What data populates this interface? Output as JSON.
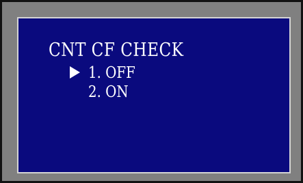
{
  "menu": {
    "title": "CNT CF CHECK",
    "selected_index": 0,
    "selection_indicator": "right-pointer-icon",
    "items": [
      {
        "label": "1. OFF"
      },
      {
        "label": "2. ON"
      }
    ]
  },
  "colors": {
    "screen_background": "#0a0a7e",
    "text": "#ffffff",
    "frame": "#808080"
  }
}
